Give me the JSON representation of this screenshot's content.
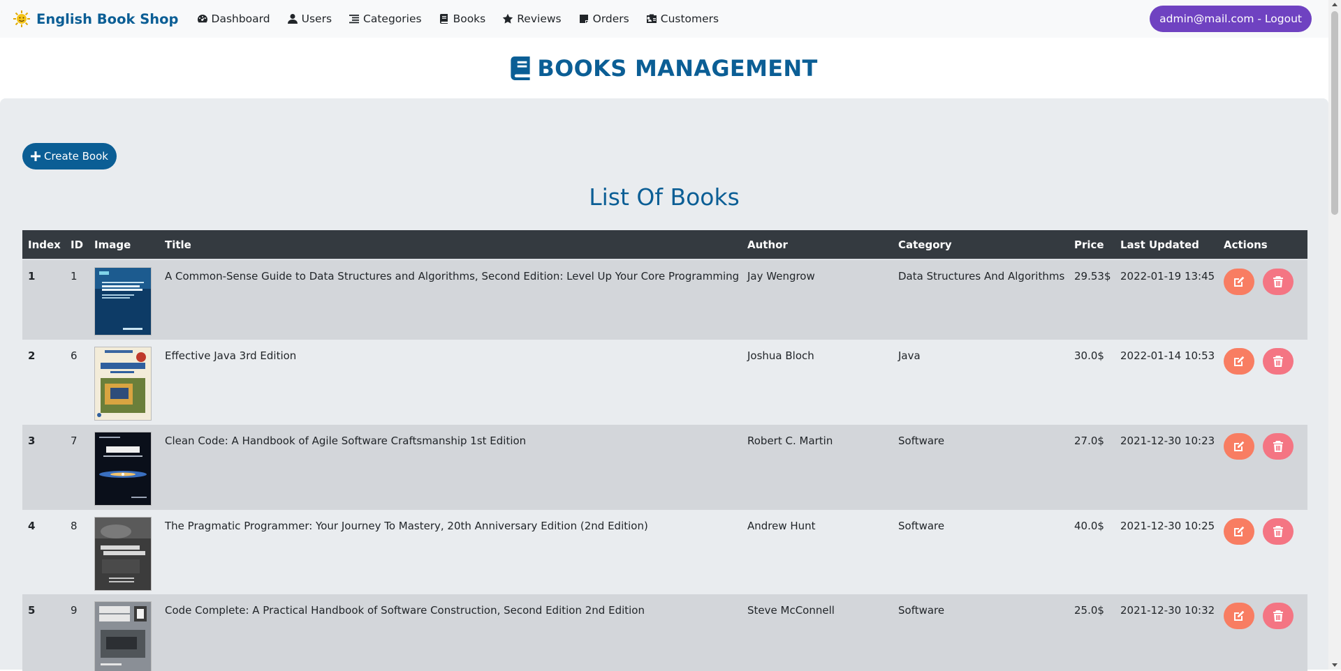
{
  "nav": {
    "brand": "English Book Shop",
    "links": [
      {
        "label": "Dashboard",
        "icon": "dashboard-icon"
      },
      {
        "label": "Users",
        "icon": "user-icon"
      },
      {
        "label": "Categories",
        "icon": "list-icon"
      },
      {
        "label": "Books",
        "icon": "book-icon"
      },
      {
        "label": "Reviews",
        "icon": "star-icon"
      },
      {
        "label": "Orders",
        "icon": "sticky-note-icon"
      },
      {
        "label": "Customers",
        "icon": "id-badge-icon"
      }
    ],
    "logout": "admin@mail.com - Logout"
  },
  "header": {
    "title": "BOOKS MANAGEMENT",
    "icon": "book-icon"
  },
  "toolbar": {
    "create_label": "Create Book",
    "icon": "plus-icon"
  },
  "list_title": "List Of Books",
  "table": {
    "columns": [
      "Index",
      "ID",
      "Image",
      "Title",
      "Author",
      "Category",
      "Price",
      "Last Updated",
      "Actions"
    ],
    "rows": [
      {
        "index": "1",
        "id": "1",
        "cover": "data-structures-cover",
        "title": "A Common-Sense Guide to Data Structures and Algorithms, Second Edition: Level Up Your Core Programming",
        "author": "Jay Wengrow",
        "category": "Data Structures And Algorithms",
        "price": "29.53$",
        "updated": "2022-01-19 13:45"
      },
      {
        "index": "2",
        "id": "6",
        "cover": "effective-java-cover",
        "title": "Effective Java 3rd Edition",
        "author": "Joshua Bloch",
        "category": "Java",
        "price": "30.0$",
        "updated": "2022-01-14 10:53"
      },
      {
        "index": "3",
        "id": "7",
        "cover": "clean-code-cover",
        "title": "Clean Code: A Handbook of Agile Software Craftsmanship 1st Edition",
        "author": "Robert C. Martin",
        "category": "Software",
        "price": "27.0$",
        "updated": "2021-12-30 10:23"
      },
      {
        "index": "4",
        "id": "8",
        "cover": "pragmatic-programmer-cover",
        "title": "The Pragmatic Programmer: Your Journey To Mastery, 20th Anniversary Edition (2nd Edition)",
        "author": "Andrew Hunt",
        "category": "Software",
        "price": "40.0$",
        "updated": "2021-12-30 10:25"
      },
      {
        "index": "5",
        "id": "9",
        "cover": "code-complete-cover",
        "title": "Code Complete: A Practical Handbook of Software Construction, Second Edition 2nd Edition",
        "author": "Steve McConnell",
        "category": "Software",
        "price": "25.0$",
        "updated": "2021-12-30 10:32"
      }
    ]
  },
  "colors": {
    "brand": "#0b5e95",
    "logout": "#6f42c1",
    "edit": "#f87d62",
    "delete": "#f47583",
    "table_head": "#343a40"
  }
}
